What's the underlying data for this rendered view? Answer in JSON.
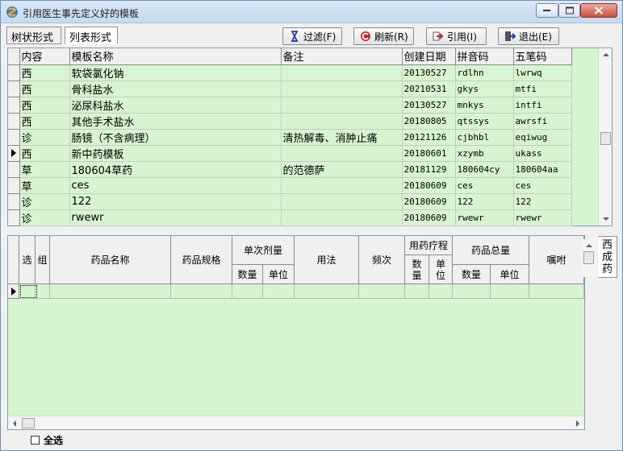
{
  "window": {
    "title": "引用医生事先定义好的模板"
  },
  "tabs": {
    "tree": "树状形式",
    "list": "列表形式"
  },
  "toolbar": {
    "filter": "过滤(F)",
    "refresh": "刷新(R)",
    "reference": "引用(I)",
    "exit": "退出(E)"
  },
  "template_grid": {
    "columns": [
      "内容",
      "模板名称",
      "备注",
      "创建日期",
      "拼音码",
      "五笔码"
    ],
    "rows": [
      [
        "西",
        "软袋氯化钠",
        "",
        "20130527",
        "rdlhn",
        "lwrwq"
      ],
      [
        "西",
        "骨科盐水",
        "",
        "20210531",
        "gkys",
        "mtfi"
      ],
      [
        "西",
        "泌尿科盐水",
        "",
        "20130527",
        "mnkys",
        "intfi"
      ],
      [
        "西",
        "其他手术盐水",
        "",
        "20180805",
        "qtssys",
        "awrsfi"
      ],
      [
        "诊",
        "肠镜（不含病理）",
        "清热解毒、消肿止痛",
        "20121126",
        "cjbhbl",
        "eqiwug"
      ],
      [
        "西",
        "新中药模板",
        "",
        "20180601",
        "xzymb",
        "ukass"
      ],
      [
        "草",
        "180604草药",
        "的范德萨",
        "20181129",
        "180604cy",
        "180604aa"
      ],
      [
        "草",
        "ces",
        "",
        "20180609",
        "ces",
        "ces"
      ],
      [
        "诊",
        "122",
        "",
        "20180609",
        "122",
        "122"
      ],
      [
        "诊",
        "rwewr",
        "",
        "20180609",
        "rwewr",
        "rwewr"
      ]
    ],
    "current_row": 5
  },
  "drug_grid": {
    "headers": {
      "select": "选",
      "group": "组",
      "drug_name": "药品名称",
      "drug_spec": "药品规格",
      "single_dose": "单次剂量",
      "single_qty": "数量",
      "single_unit": "单位",
      "usage": "用法",
      "frequency": "频次",
      "course": "用药疗程",
      "course_qty": "数\n量",
      "course_unit": "单\n位",
      "total": "药品总量",
      "total_qty": "数量",
      "total_unit": "单位",
      "advice": "嘱咐"
    }
  },
  "side_tab": {
    "label": "西成药"
  },
  "select_all": {
    "label": "全选",
    "checked": false
  }
}
